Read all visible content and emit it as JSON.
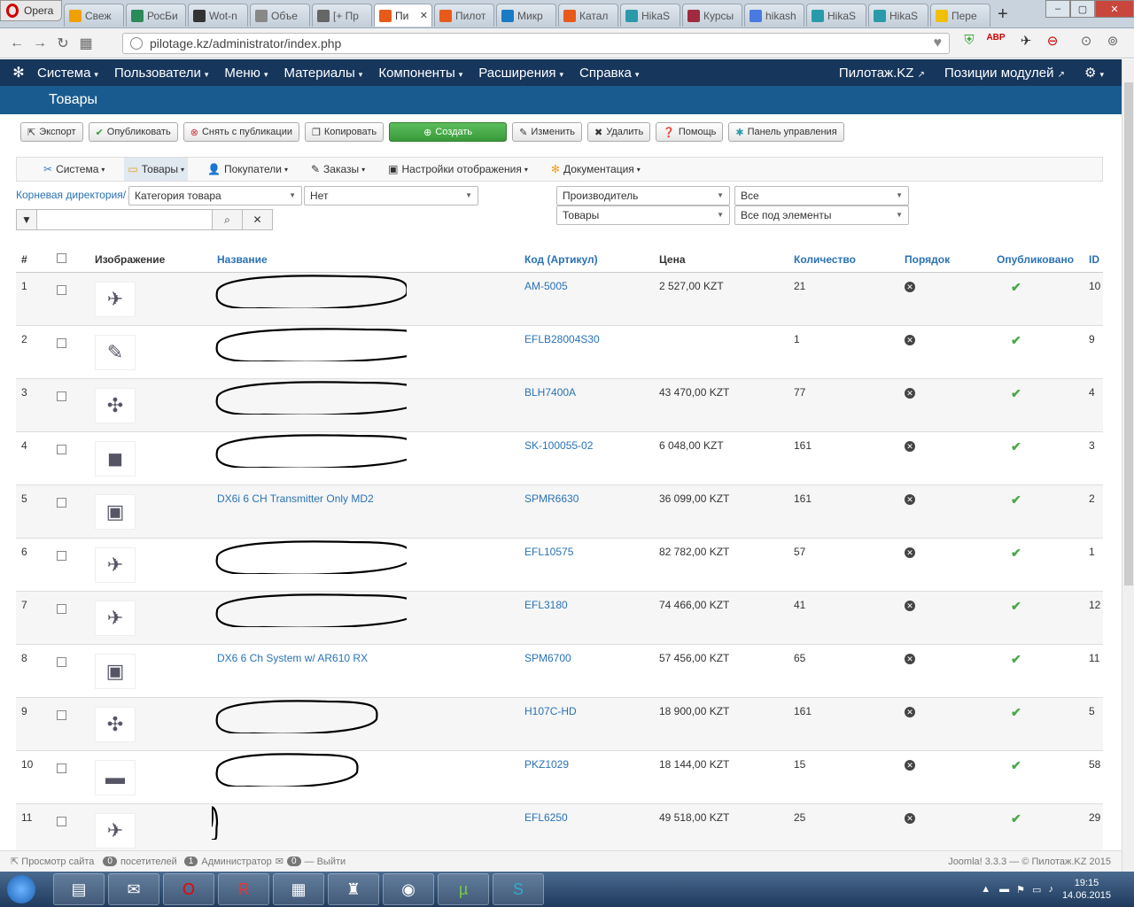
{
  "browser": {
    "menu_label": "Opera",
    "tabs": [
      {
        "label": "Свеж",
        "color": "#f0a000"
      },
      {
        "label": "РосБи",
        "color": "#2a8a5a"
      },
      {
        "label": "Wot-n",
        "color": "#333333"
      },
      {
        "label": "Объе",
        "color": "#888888"
      },
      {
        "label": "[+ Пр",
        "color": "#666666"
      },
      {
        "label": "Пи",
        "color": "#e85a1a",
        "active": true
      },
      {
        "label": "Пилот",
        "color": "#e85a1a"
      },
      {
        "label": "Микр",
        "color": "#1a7ac4"
      },
      {
        "label": "Катал",
        "color": "#e85a1a"
      },
      {
        "label": "HikaS",
        "color": "#2a9aaa"
      },
      {
        "label": "Курсы",
        "color": "#a02a40"
      },
      {
        "label": "hikash",
        "color": "#4a7ae0"
      },
      {
        "label": "HikaS",
        "color": "#2a9aaa"
      },
      {
        "label": "HikaS",
        "color": "#2a9aaa"
      },
      {
        "label": "Пере",
        "color": "#f0c000"
      }
    ],
    "url": "pilotage.kz/administrator/index.php"
  },
  "topnav": {
    "items": [
      "Система",
      "Пользователи",
      "Меню",
      "Материалы",
      "Компоненты",
      "Расширения",
      "Справка"
    ],
    "site_link": "Пилотаж.KZ",
    "positions_link": "Позиции модулей"
  },
  "page_title": "Товары",
  "toolbar": {
    "export": "Экспорт",
    "publish": "Опубликовать",
    "unpublish": "Снять с публикации",
    "copy": "Копировать",
    "create": "Создать",
    "edit": "Изменить",
    "delete": "Удалить",
    "help": "Помощь",
    "dashboard": "Панель управления"
  },
  "submenu": {
    "items": [
      "Система",
      "Товары",
      "Покупатели",
      "Заказы",
      "Настройки отображения",
      "Документация"
    ]
  },
  "filters": {
    "root_link": "Корневая директория/",
    "category": "Категория товара",
    "none": "Нет",
    "manufacturer": "Производитель",
    "all": "Все",
    "products": "Товары",
    "all_sub": "Все под элементы"
  },
  "table": {
    "headers": {
      "num": "#",
      "image": "Изображение",
      "name": "Название",
      "code": "Код (Артикул)",
      "price": "Цена",
      "qty": "Количество",
      "order": "Порядок",
      "published": "Опубликовано",
      "id": "ID"
    },
    "rows": [
      {
        "num": "1",
        "name": "",
        "code": "AM-5005",
        "price": "2 527,00 KZT",
        "qty": "21",
        "id": "10"
      },
      {
        "num": "2",
        "name": "",
        "code": "EFLB28004S30",
        "price": "",
        "qty": "1",
        "id": "9"
      },
      {
        "num": "3",
        "name": "",
        "code": "BLH7400A",
        "price": "43 470,00 KZT",
        "qty": "77",
        "id": "4"
      },
      {
        "num": "4",
        "name": "",
        "code": "SK-100055-02",
        "price": "6 048,00 KZT",
        "qty": "161",
        "id": "3"
      },
      {
        "num": "5",
        "name": "DX6i 6 CH Transmitter Only MD2",
        "code": "SPMR6630",
        "price": "36 099,00 KZT",
        "qty": "161",
        "id": "2"
      },
      {
        "num": "6",
        "name": "",
        "code": "EFL10575",
        "price": "82 782,00 KZT",
        "qty": "57",
        "id": "1"
      },
      {
        "num": "7",
        "name": "",
        "code": "EFL3180",
        "price": "74 466,00 KZT",
        "qty": "41",
        "id": "12"
      },
      {
        "num": "8",
        "name": "DX6 6 Ch System w/ AR610 RX",
        "code": "SPM6700",
        "price": "57 456,00 KZT",
        "qty": "65",
        "id": "11"
      },
      {
        "num": "9",
        "name": "",
        "code": "H107C-HD",
        "price": "18 900,00 KZT",
        "qty": "161",
        "id": "5"
      },
      {
        "num": "10",
        "name": "",
        "code": "PKZ1029",
        "price": "18 144,00 KZT",
        "qty": "15",
        "id": "58"
      },
      {
        "num": "11",
        "name": "",
        "code": "EFL6250",
        "price": "49 518,00 KZT",
        "qty": "25",
        "id": "29"
      }
    ]
  },
  "statusbar": {
    "view_site": "Просмотр сайта",
    "visitors_count": "0",
    "visitors": "посетителей",
    "admins_count": "1",
    "admins": "Администратор",
    "messages_count": "0",
    "logout": "Выйти",
    "version": "Joomla! 3.3.3 — © Пилотаж.KZ 2015"
  },
  "taskbar": {
    "time": "19:15",
    "date": "14.06.2015"
  },
  "colors": {
    "nav_bg": "#17365c",
    "header_bg": "#1a5b8f",
    "link": "#2a72b5",
    "create_btn": "#4aa84a"
  }
}
